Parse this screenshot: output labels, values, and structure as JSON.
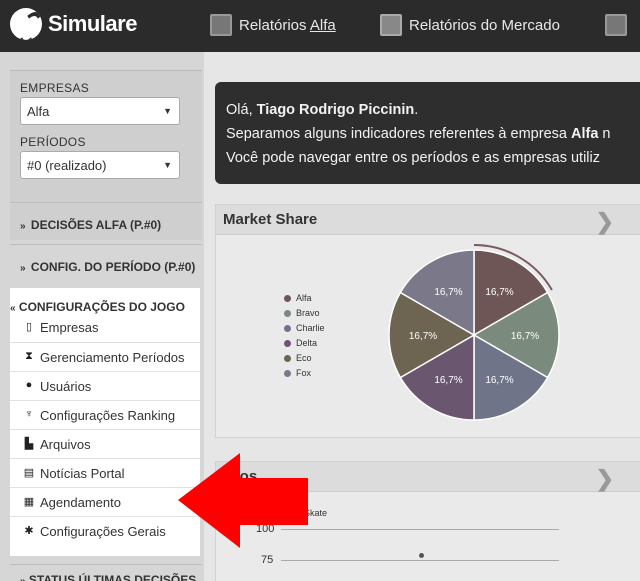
{
  "topbar": {
    "brand": "Simulare",
    "nav": [
      {
        "pre": "Relatórios ",
        "hl": "Alfa"
      },
      {
        "pre": "Relatórios do Mercado",
        "hl": ""
      }
    ]
  },
  "sidebar": {
    "empresas_label": "EMPRESAS",
    "empresas_value": "Alfa",
    "periodos_label": "PERÍODOS",
    "periodos_value": "#0 (realizado)",
    "sections": [
      {
        "chev": "»",
        "label": "DECISÕES ALFA (P.#0)"
      },
      {
        "chev": "»",
        "label": "CONFIG. DO PERÍODO (P.#0)"
      }
    ],
    "menu_title": "CONFIGURAÇÕES DO JOGO",
    "menu_chev": "«",
    "menu_items": [
      {
        "icon": "▯",
        "label": "Empresas"
      },
      {
        "icon": "⧗",
        "label": "Gerenciamento Períodos"
      },
      {
        "icon": "●",
        "label": "Usuários"
      },
      {
        "icon": "♆",
        "label": "Configurações Ranking"
      },
      {
        "icon": "▙",
        "label": "Arquivos"
      },
      {
        "icon": "▤",
        "label": "Notícias Portal"
      },
      {
        "icon": "▦",
        "label": "Agendamento"
      },
      {
        "icon": "✱",
        "label": "Configurações Gerais"
      }
    ],
    "bottom_section": "STATUS ÚLTIMAS DECISÕES"
  },
  "welcome": {
    "greeting_pre": "Olá, ",
    "greeting_name": "Tiago Rodrigo Piccinin",
    "greeting_post": ".",
    "line2_pre": "Separamos alguns indicadores referentes à empresa ",
    "line2_company": "Alfa",
    "line2_post": " n",
    "line3": "Você pode navegar entre os períodos e as empresas utiliz"
  },
  "market_share": {
    "title": "Market Share",
    "arrow": "❯"
  },
  "chart_data": [
    {
      "type": "pie",
      "title": "Market Share",
      "categories": [
        "Alfa",
        "Bravo",
        "Charlie",
        "Delta",
        "Eco",
        "Fox"
      ],
      "values": [
        16.7,
        16.7,
        16.7,
        16.7,
        16.7,
        16.7
      ],
      "labels": [
        "16,7%",
        "16,7%",
        "16,7%",
        "16,7%",
        "16,7%",
        "16,7%"
      ],
      "colors": [
        "#6e5556",
        "#7a8a7c",
        "#6f7488",
        "#6b5670",
        "#6e6452",
        "#7a7889"
      ],
      "legend_position": "left"
    }
  ],
  "precos": {
    "title": "ecos",
    "arrow": "❯",
    "series_label": "Skate",
    "yticks": [
      "100",
      "75"
    ]
  },
  "colors": {
    "topbar": "#2b2b2b",
    "highlight_arrow": "#ff0000"
  }
}
